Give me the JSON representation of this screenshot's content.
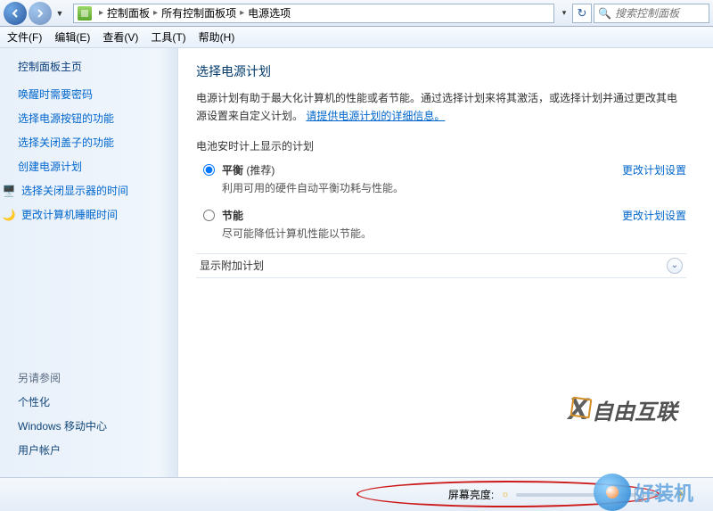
{
  "nav": {
    "breadcrumb_root_icon": "system",
    "crumbs": [
      "控制面板",
      "所有控制面板项",
      "电源选项"
    ],
    "search_placeholder": "搜索控制面板"
  },
  "menubar": [
    {
      "label": "文件(F)"
    },
    {
      "label": "编辑(E)"
    },
    {
      "label": "查看(V)"
    },
    {
      "label": "工具(T)"
    },
    {
      "label": "帮助(H)"
    }
  ],
  "sidebar": {
    "home": "控制面板主页",
    "links": [
      {
        "label": "唤醒时需要密码"
      },
      {
        "label": "选择电源按钮的功能"
      },
      {
        "label": "选择关闭盖子的功能"
      },
      {
        "label": "创建电源计划"
      },
      {
        "label": "选择关闭显示器的时间",
        "icon": "display"
      },
      {
        "label": "更改计算机睡眠时间",
        "icon": "sleep"
      }
    ],
    "see_also_header": "另请参阅",
    "see_also": [
      {
        "label": "个性化"
      },
      {
        "label": "Windows 移动中心"
      },
      {
        "label": "用户帐户"
      }
    ]
  },
  "content": {
    "title": "选择电源计划",
    "desc_prefix": "电源计划有助于最大化计算机的性能或者节能。通过选择计划来将其激活，或选择计划并通过更改其电源设置来自定义计划。",
    "desc_link": "请提供电源计划的详细信息。",
    "subhead": "电池安时计上显示的计划",
    "plans": [
      {
        "name": "平衡",
        "rec": " (推荐)",
        "desc": "利用可用的硬件自动平衡功耗与性能。",
        "selected": true,
        "settings_label": "更改计划设置"
      },
      {
        "name": "节能",
        "rec": "",
        "desc": "尽可能降低计算机性能以节能。",
        "selected": false,
        "settings_label": "更改计划设置"
      }
    ],
    "expander_label": "显示附加计划"
  },
  "bottom": {
    "brightness_label": "屏幕亮度:"
  },
  "watermarks": {
    "w1": "自由互联",
    "w2": "好装机"
  }
}
